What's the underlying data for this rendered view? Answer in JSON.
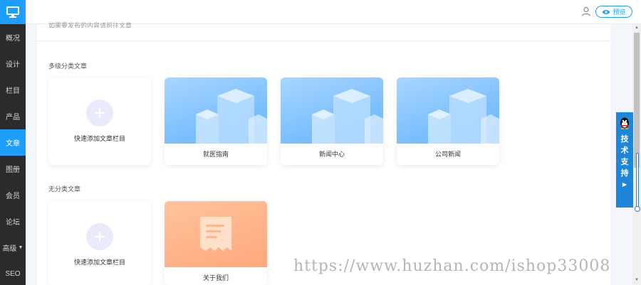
{
  "sidebar": {
    "logo_icon": "monitor-icon",
    "items": [
      {
        "label": "概况"
      },
      {
        "label": "设计"
      },
      {
        "label": "栏目"
      },
      {
        "label": "产品"
      },
      {
        "label": "文章",
        "active": true
      },
      {
        "label": "图册"
      },
      {
        "label": "会员"
      },
      {
        "label": "论坛"
      },
      {
        "label": "高级",
        "has_caret": true
      },
      {
        "label": "SEO"
      }
    ],
    "colors": {
      "bg": "#2b2b2b",
      "active": "#1e9fff"
    }
  },
  "topbar": {
    "user_icon": "user-icon",
    "preview_label": "预览",
    "preview_icon": "eye-icon"
  },
  "main": {
    "partial_top_text": "如果要发布的内容请前往文章",
    "sections": [
      {
        "title": "多级分类文章",
        "add_label": "快速添加文章栏目",
        "cards": [
          {
            "label": "就医指南",
            "thumb": "building-illustration-blue"
          },
          {
            "label": "新闻中心",
            "thumb": "building-illustration-blue"
          },
          {
            "label": "公司新闻",
            "thumb": "building-illustration-blue"
          }
        ]
      },
      {
        "title": "无分类文章",
        "add_label": "快速添加文章栏目",
        "cards": [
          {
            "label": "关于我们",
            "thumb": "document-illustration-orange"
          }
        ]
      }
    ]
  },
  "support": {
    "label": "技术支持",
    "icon": "qq-penguin-icon"
  },
  "watermark": "https://www.huzhan.com/ishop33008"
}
